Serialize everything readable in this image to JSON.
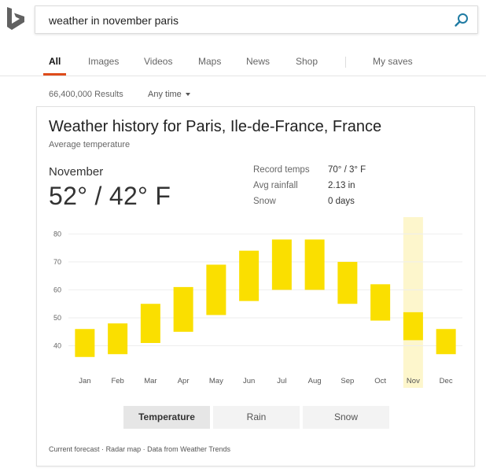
{
  "search": {
    "query": "weather in november paris"
  },
  "tabs": [
    {
      "label": "All",
      "active": true
    },
    {
      "label": "Images"
    },
    {
      "label": "Videos"
    },
    {
      "label": "Maps"
    },
    {
      "label": "News"
    },
    {
      "label": "Shop"
    },
    {
      "label": "My saves"
    }
  ],
  "results_bar": {
    "count": "66,400,000 Results",
    "time_filter": "Any time"
  },
  "weather": {
    "title": "Weather history for Paris, Ile-de-France, France",
    "subtitle": "Average temperature",
    "month": "November",
    "temps": "52° / 42° F",
    "stats": [
      {
        "label": "Record temps",
        "value": "70° / 3° F"
      },
      {
        "label": "Avg rainfall",
        "value": "2.13 in"
      },
      {
        "label": "Snow",
        "value": "0 days"
      }
    ],
    "toggles": [
      {
        "label": "Temperature",
        "active": true
      },
      {
        "label": "Rain"
      },
      {
        "label": "Snow"
      }
    ],
    "footer": {
      "forecast": "Current forecast",
      "sep": "·",
      "radar": "Radar map",
      "source": "Data from Weather Trends"
    }
  },
  "colors": {
    "bar": "#fadf00",
    "highlight": "#fdf6cc",
    "accent": "#de4b1a",
    "search_icon": "#1f7ba3"
  },
  "chart_data": {
    "type": "bar",
    "subtype": "floating-range",
    "categories": [
      "Jan",
      "Feb",
      "Mar",
      "Apr",
      "May",
      "Jun",
      "Jul",
      "Aug",
      "Sep",
      "Oct",
      "Nov",
      "Dec"
    ],
    "series": [
      {
        "name": "low",
        "values": [
          36,
          37,
          41,
          45,
          51,
          56,
          60,
          60,
          55,
          49,
          42,
          37
        ]
      },
      {
        "name": "high",
        "values": [
          46,
          48,
          55,
          61,
          69,
          74,
          78,
          78,
          70,
          62,
          52,
          46
        ]
      }
    ],
    "highlight_category": "Nov",
    "yticks": [
      40,
      50,
      60,
      70,
      80
    ],
    "ylim": [
      32,
      86
    ],
    "grid": true
  }
}
